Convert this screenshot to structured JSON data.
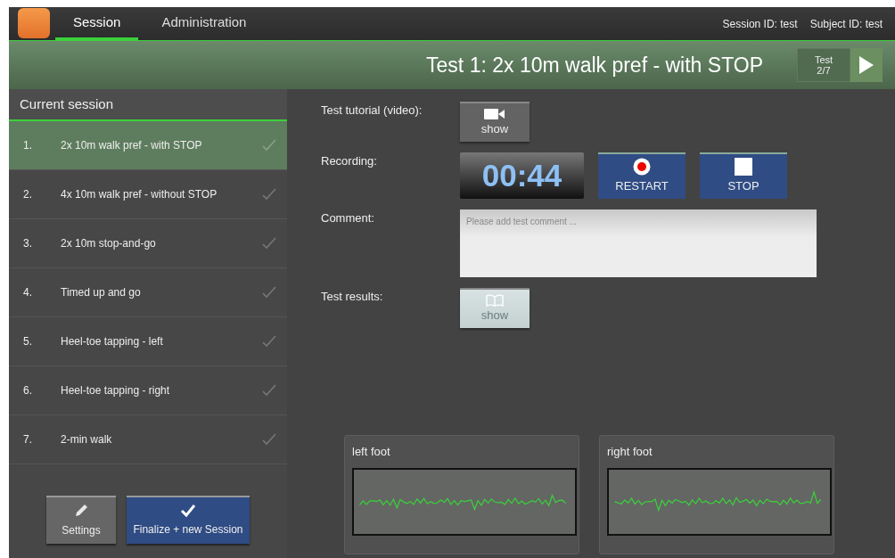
{
  "app_bar": {
    "tabs": [
      {
        "label": "Session",
        "selected": true
      },
      {
        "label": "Administration",
        "selected": false
      }
    ],
    "session_id": "Session ID: test",
    "subject_id": "Subject ID: test"
  },
  "header": {
    "title": "Test 1: 2x 10m walk pref - with STOP",
    "counter_label": "Test",
    "counter": "2/7"
  },
  "sidebar": {
    "title": "Current session",
    "items": [
      {
        "number": "1.",
        "label": "2x 10m walk pref - with STOP",
        "selected": true
      },
      {
        "number": "2.",
        "label": "4x 10m walk pref - without STOP",
        "selected": false
      },
      {
        "number": "3.",
        "label": "2x 10m stop-and-go",
        "selected": false
      },
      {
        "number": "4.",
        "label": "Timed up and go",
        "selected": false
      },
      {
        "number": "5.",
        "label": "Heel-toe tapping - left",
        "selected": false
      },
      {
        "number": "6.",
        "label": "Heel-toe tapping - right",
        "selected": false
      },
      {
        "number": "7.",
        "label": "2-min walk",
        "selected": false
      }
    ],
    "buttons": [
      {
        "kind": "settings",
        "label": "Settings"
      },
      {
        "kind": "finalize",
        "label": "Finalize + new Session"
      }
    ]
  },
  "form": {
    "tutorial": {
      "label": "Test tutorial (video):",
      "button": "show",
      "disabled": false
    },
    "recording": {
      "label": "Recording:",
      "timer": "00:44",
      "restart": "RESTART",
      "stop": "STOP"
    },
    "comment": {
      "label": "Comment:",
      "placeholder": "Please add test comment ..."
    },
    "results": {
      "label": "Test results:",
      "button": "show",
      "disabled": true
    }
  },
  "sensors": [
    {
      "title": "left foot"
    },
    {
      "title": "right foot"
    }
  ]
}
